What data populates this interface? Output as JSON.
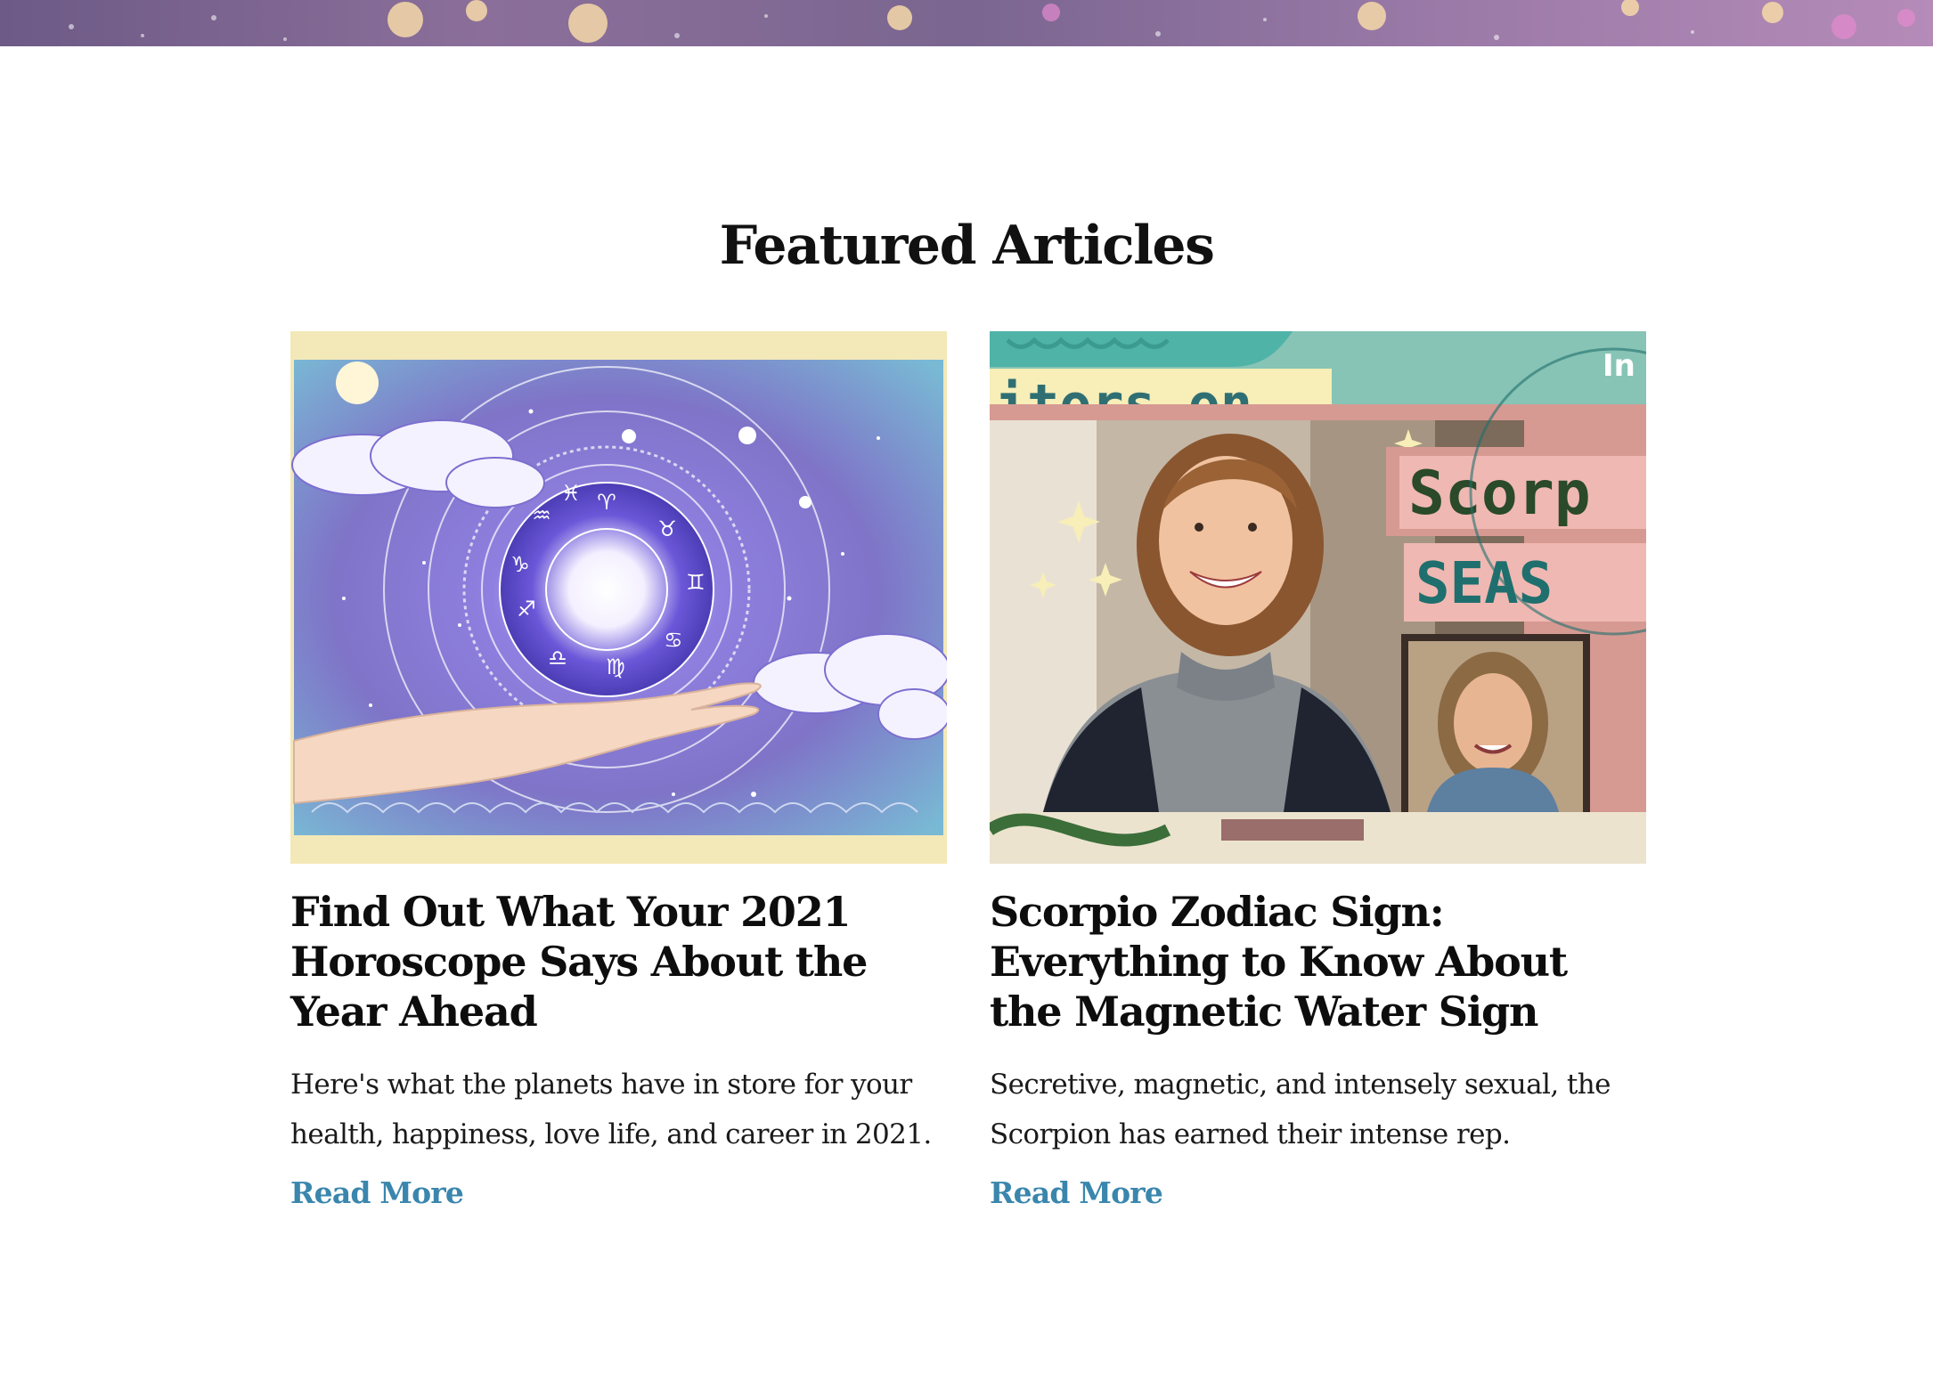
{
  "section": {
    "title": "Featured Articles"
  },
  "articles": [
    {
      "title": "Find Out What Your 2021 Horoscope Says About the Year Ahead",
      "description": "Here's what the planets have in store for your health, happiness, love life, and career in 2021.",
      "link_label": "Read More",
      "image_icon": "zodiac-wheel-hand-image"
    },
    {
      "title": "Scorpio Zodiac Sign: Everything to Know About the Magnetic Water Sign",
      "description": "Secretive, magnetic, and intensely sexual, the Scorpion has earned their intense rep.",
      "link_label": "Read More",
      "image_icon": "video-thumbnail-image",
      "image_text": {
        "banner": "itors on...",
        "word1": "Scorp",
        "word2": "SEAS",
        "corner": "In"
      }
    }
  ],
  "colors": {
    "link": "#3a86ad",
    "heading": "#0d0d0d",
    "frame_cream": "#f3e8b8",
    "teal": "#4fb3a8"
  }
}
